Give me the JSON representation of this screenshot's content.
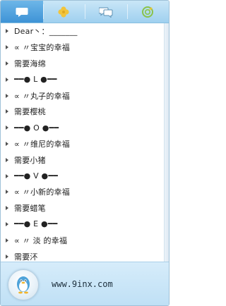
{
  "tabs": [
    {
      "name": "chat-bubble-icon",
      "active": true
    },
    {
      "name": "clover-icon",
      "active": false
    },
    {
      "name": "group-chat-icon",
      "active": false
    },
    {
      "name": "zone-icon",
      "active": false
    }
  ],
  "list": {
    "items": [
      {
        "label": "Dear丶：_______"
      },
      {
        "label": "∝ 〃宝宝的幸福"
      },
      {
        "label": "需要海绵"
      },
      {
        "label": "━━● L ●━━"
      },
      {
        "label": "∝ 〃丸子的幸福"
      },
      {
        "label": "需要樱桃"
      },
      {
        "label": "━━● O ●━━"
      },
      {
        "label": "∝ 〃维尼的幸福"
      },
      {
        "label": "需要小猪"
      },
      {
        "label": "━━● V ●━━"
      },
      {
        "label": "∝ 〃小新的幸福"
      },
      {
        "label": "需要蜡笔"
      },
      {
        "label": "━━● E ●━━"
      },
      {
        "label": "∝ 〃 淡 的幸福"
      },
      {
        "label": "需要㳅"
      }
    ]
  },
  "footer": {
    "avatar_icon": "penguin-avatar-icon",
    "site_text": "www.9inx.com"
  },
  "colors": {
    "tab_active": "#3e93d6",
    "tab_bar": "#b4dcf3",
    "footer_bg": "#cbe6f8"
  }
}
